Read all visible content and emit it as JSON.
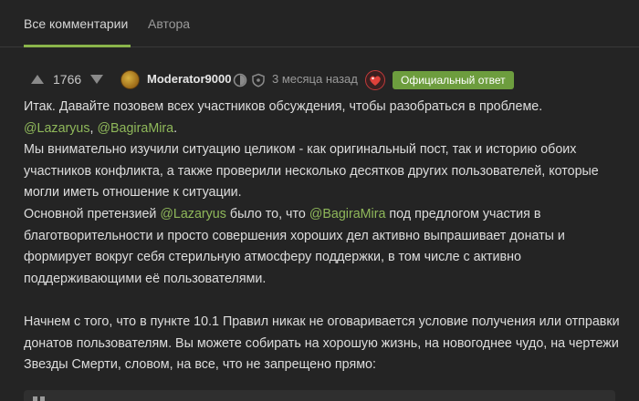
{
  "tabs": [
    {
      "label": "Все комментарии",
      "active": true
    },
    {
      "label": "Автора",
      "active": false
    }
  ],
  "comment": {
    "rating": "1766",
    "author": "Moderator9000",
    "time": "3 месяца назад",
    "badge": "Официальный ответ",
    "icons": [
      "upvote-arrow-icon",
      "downvote-arrow-icon",
      "avatar",
      "verified-icon",
      "shield-icon",
      "heart-badge-icon"
    ],
    "colors": {
      "accent": "#8ab44a",
      "badge_bg": "#6d9d3e",
      "mention": "#8fb85a",
      "background": "#242424"
    },
    "lines": {
      "l1": "Итак. Давайте позовем всех участников обсуждения, чтобы разобраться в проблеме.",
      "l2_m1": "@Lazaryus",
      "l2_sep": ", ",
      "l2_m2": "@BagiraMira",
      "l2_end": ".",
      "l3": "Мы внимательно изучили ситуацию целиком - как оригинальный пост, так и историю обоих",
      "l4": "участников конфликта, а также проверили несколько десятков других пользователей, которые",
      "l5": "могли иметь отношение к ситуации.",
      "l6_pre": "Основной претензией ",
      "l6_m1": "@Lazaryus",
      "l6_mid": " было то, что ",
      "l6_m2": "@BagiraMira",
      "l6_post": " под предлогом участия в",
      "l7": "благотворительности и просто совершения хороших дел активно выпрашивает донаты и",
      "l8": "формирует вокруг себя стерильную атмосферу поддержки, в том числе с активно",
      "l9": "поддерживающими её пользователями.",
      "l11": "Начнем с того, что в пункте 10.1 Правил никак не оговаривается условие получения или отправки",
      "l12": "донатов пользователям. Вы можете собирать на хорошую жизнь, на новогоднее чудо, на чертежи",
      "l13": "Звезды Смерти, словом, на все, что не запрещено прямо:"
    }
  }
}
